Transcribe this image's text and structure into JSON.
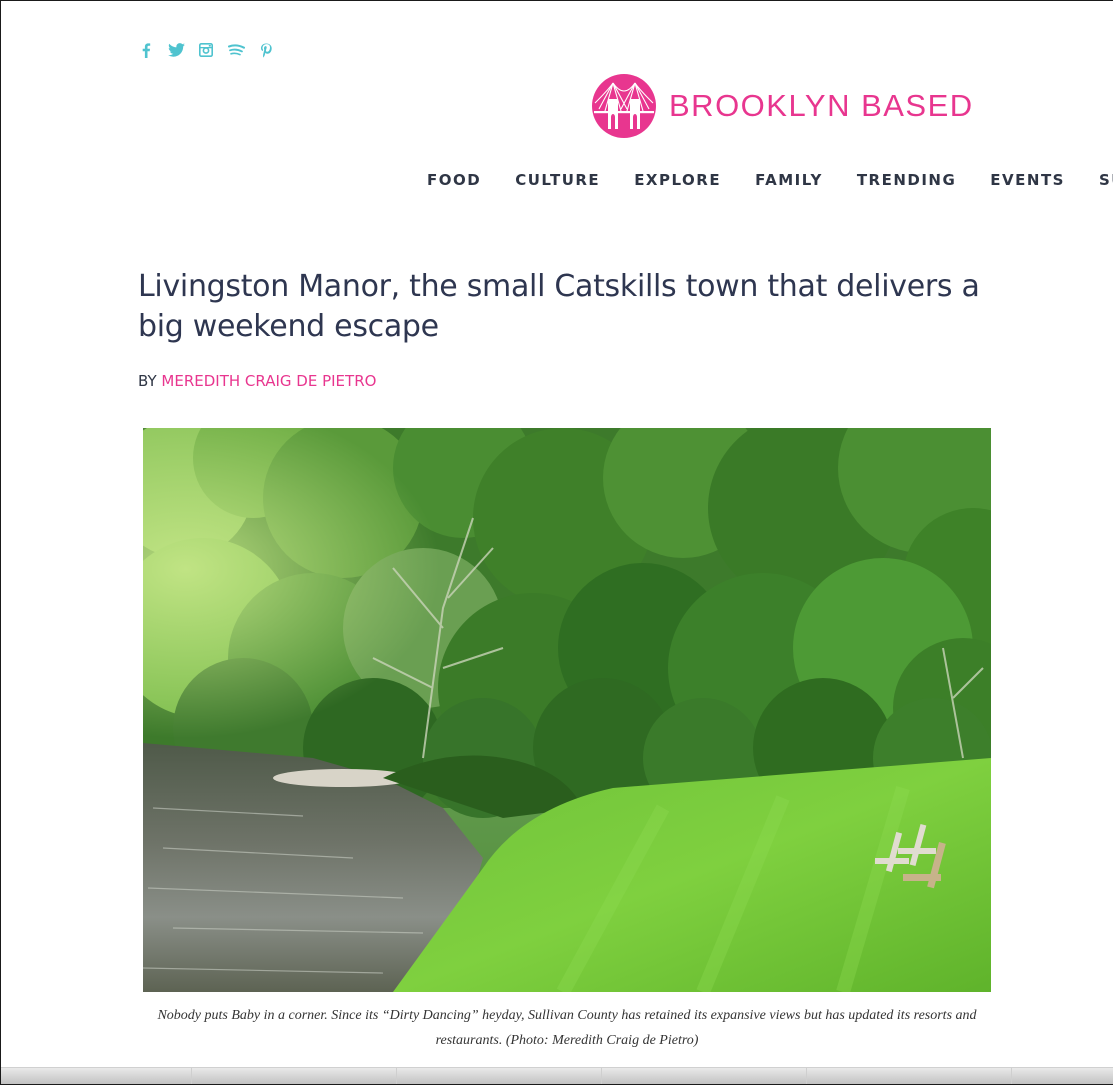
{
  "social": [
    {
      "name": "facebook-icon"
    },
    {
      "name": "twitter-icon"
    },
    {
      "name": "instagram-icon"
    },
    {
      "name": "spotify-icon"
    },
    {
      "name": "pinterest-icon"
    }
  ],
  "brand": {
    "name": "BROOKLYN BASED",
    "accent_color": "#e8368f",
    "social_color": "#4fc3cf"
  },
  "nav": {
    "items": [
      "FOOD",
      "CULTURE",
      "EXPLORE",
      "FAMILY",
      "TRENDING",
      "EVENTS",
      "SUMMER"
    ]
  },
  "article": {
    "title": "Livingston Manor, the small Catskills town that delivers a big weekend escape",
    "by_label": "BY",
    "author": "MEREDITH CRAIG DE PIETRO",
    "caption": "Nobody puts Baby in a corner. Since its “Dirty Dancing” heyday, Sullivan County has retained its expansive views but has updated its resorts and restaurants. (Photo: Meredith Craig de Pietro)"
  }
}
